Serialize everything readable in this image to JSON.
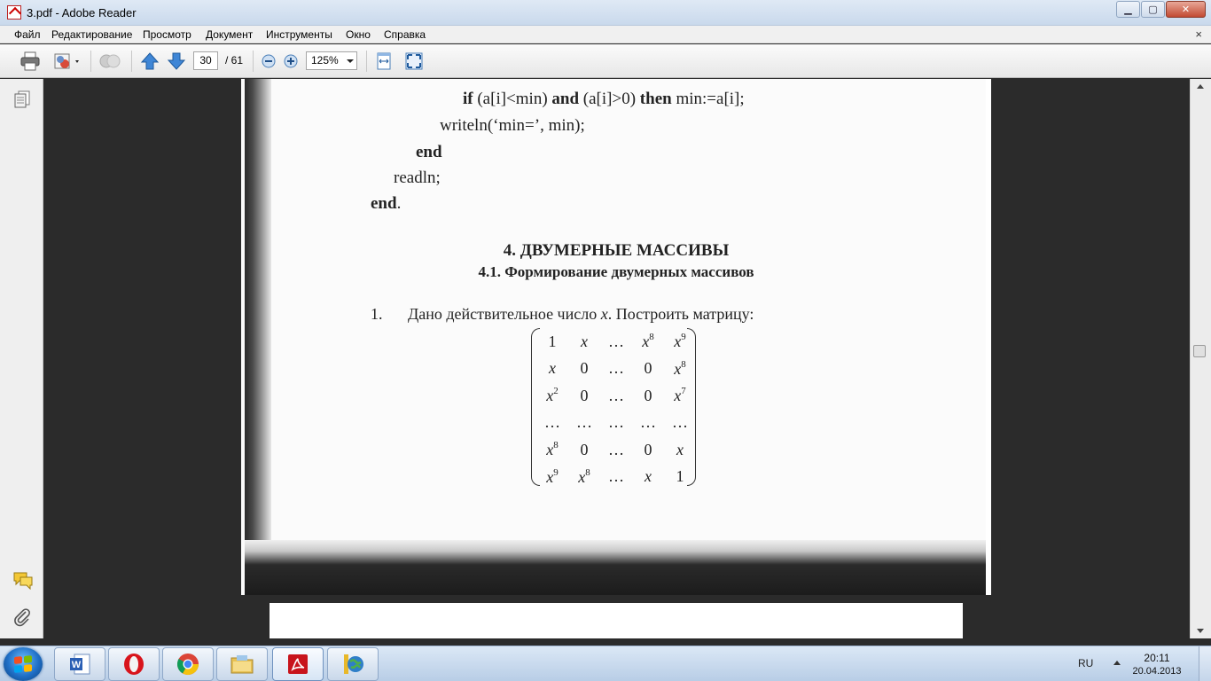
{
  "window": {
    "title": "3.pdf - Adobe Reader",
    "minimize": "▁",
    "maximize": "▢",
    "close": "✕"
  },
  "menu": {
    "items": [
      "Файл",
      "Редактирование",
      "Просмотр",
      "Документ",
      "Инструменты",
      "Окно",
      "Справка"
    ],
    "close_doc": "×"
  },
  "toolbar": {
    "current_page": "30",
    "total_pages": "/ 61",
    "zoom": "125%"
  },
  "icons": {
    "print": "print-icon",
    "share": "share-icon",
    "collaborate": "collaborate-icon",
    "page_up": "arrow-up-icon",
    "page_down": "arrow-down-icon",
    "zoom_out": "zoom-out-icon",
    "zoom_in": "zoom-in-icon",
    "fit_width": "fit-width-icon",
    "full_screen": "full-screen-icon",
    "pages_panel": "pages-icon",
    "comments": "comments-icon",
    "attachments": "paperclip-icon"
  },
  "document": {
    "code_lines": [
      {
        "parts": [
          {
            "t": "if",
            "b": true
          },
          {
            "t": " (a[i]<min) ",
            "b": false
          },
          {
            "t": "and",
            "b": true
          },
          {
            "t": " (a[i]>0) ",
            "b": false
          },
          {
            "t": "then",
            "b": true
          },
          {
            "t": " min:=a[i];",
            "b": false
          }
        ]
      },
      {
        "parts": [
          {
            "t": "writeln(‘min=’, min);",
            "b": false
          }
        ]
      },
      {
        "parts": [
          {
            "t": "end",
            "b": true
          }
        ]
      },
      {
        "parts": [
          {
            "t": "readln;",
            "b": false
          }
        ]
      },
      {
        "parts": [
          {
            "t": "end",
            "b": true
          },
          {
            "t": ".",
            "b": false
          }
        ]
      }
    ],
    "heading": "4. ДВУМЕРНЫЕ МАССИВЫ",
    "subheading": "4.1. Формирование двумерных массивов",
    "task_number": "1.",
    "task_text": "Дано действительное число x. Построить матрицу:",
    "matrix": [
      [
        {
          "v": "1",
          "up": true
        },
        {
          "v": "x"
        },
        {
          "v": "…",
          "up": true
        },
        {
          "v": "x",
          "sup": "8"
        },
        {
          "v": "x",
          "sup": "9"
        }
      ],
      [
        {
          "v": "x"
        },
        {
          "v": "0",
          "up": true
        },
        {
          "v": "…",
          "up": true
        },
        {
          "v": "0",
          "up": true
        },
        {
          "v": "x",
          "sup": "8"
        }
      ],
      [
        {
          "v": "x",
          "sup": "2"
        },
        {
          "v": "0",
          "up": true
        },
        {
          "v": "…",
          "up": true
        },
        {
          "v": "0",
          "up": true
        },
        {
          "v": "x",
          "sup": "7"
        }
      ],
      [
        {
          "v": "…",
          "up": true
        },
        {
          "v": "…",
          "up": true
        },
        {
          "v": "…",
          "up": true
        },
        {
          "v": "…",
          "up": true
        },
        {
          "v": "…",
          "up": true
        }
      ],
      [
        {
          "v": "x",
          "sup": "8"
        },
        {
          "v": "0",
          "up": true
        },
        {
          "v": "…",
          "up": true
        },
        {
          "v": "0",
          "up": true
        },
        {
          "v": "x"
        }
      ],
      [
        {
          "v": "x",
          "sup": "9"
        },
        {
          "v": "x",
          "sup": "8"
        },
        {
          "v": "…",
          "up": true
        },
        {
          "v": "x"
        },
        {
          "v": "1",
          "up": true
        }
      ]
    ]
  },
  "taskbar": {
    "apps": [
      "word-icon",
      "opera-icon",
      "chrome-icon",
      "explorer-icon",
      "adobe-reader-icon",
      "globe-app-icon"
    ],
    "language": "RU",
    "time": "20:11",
    "date": "20.04.2013"
  },
  "colors": {
    "doc_background": "#2b2b2b",
    "accent_blue": "#2f74c8",
    "reader_red": "#c8141c"
  }
}
